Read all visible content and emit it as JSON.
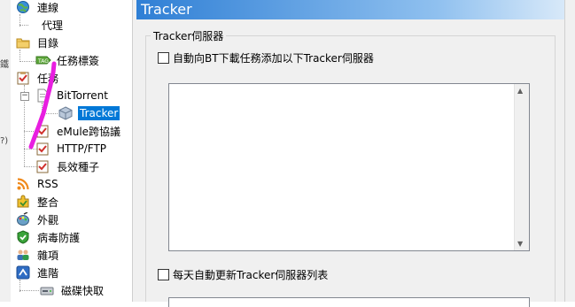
{
  "tree": {
    "items": [
      {
        "label": "連線",
        "icon": "globe-icon"
      },
      {
        "label": "代理",
        "icon": "none"
      },
      {
        "label": "目錄",
        "icon": "folder-icon"
      },
      {
        "label": "任務標簽",
        "icon": "tag-icon"
      },
      {
        "label": "任務",
        "icon": "clipboard-icon"
      },
      {
        "label": "BitTorrent",
        "icon": "document-icon"
      },
      {
        "label": "Tracker",
        "icon": "cube-icon"
      },
      {
        "label": "eMule跨協議",
        "icon": "checklist-icon"
      },
      {
        "label": "HTTP/FTP",
        "icon": "checklist-icon"
      },
      {
        "label": "長效種子",
        "icon": "checklist-icon"
      },
      {
        "label": "RSS",
        "icon": "rss-icon"
      },
      {
        "label": "整合",
        "icon": "puzzle-icon"
      },
      {
        "label": "外觀",
        "icon": "palette-icon"
      },
      {
        "label": "病毒防護",
        "icon": "shield-icon"
      },
      {
        "label": "雜項",
        "icon": "people-icon"
      },
      {
        "label": "進階",
        "icon": "advanced-icon"
      },
      {
        "label": "磁碟快取",
        "icon": "disk-icon"
      }
    ]
  },
  "panel": {
    "title": "Tracker",
    "group_title": "Tracker伺服器",
    "checkbox_add_label": "自動向BT下載任務添加以下Tracker伺服器",
    "checkbox_update_label": "每天自動更新Tracker伺服器列表",
    "checkbox_add_checked": false,
    "checkbox_update_checked": false
  },
  "annotation_color": "#e81ee0"
}
